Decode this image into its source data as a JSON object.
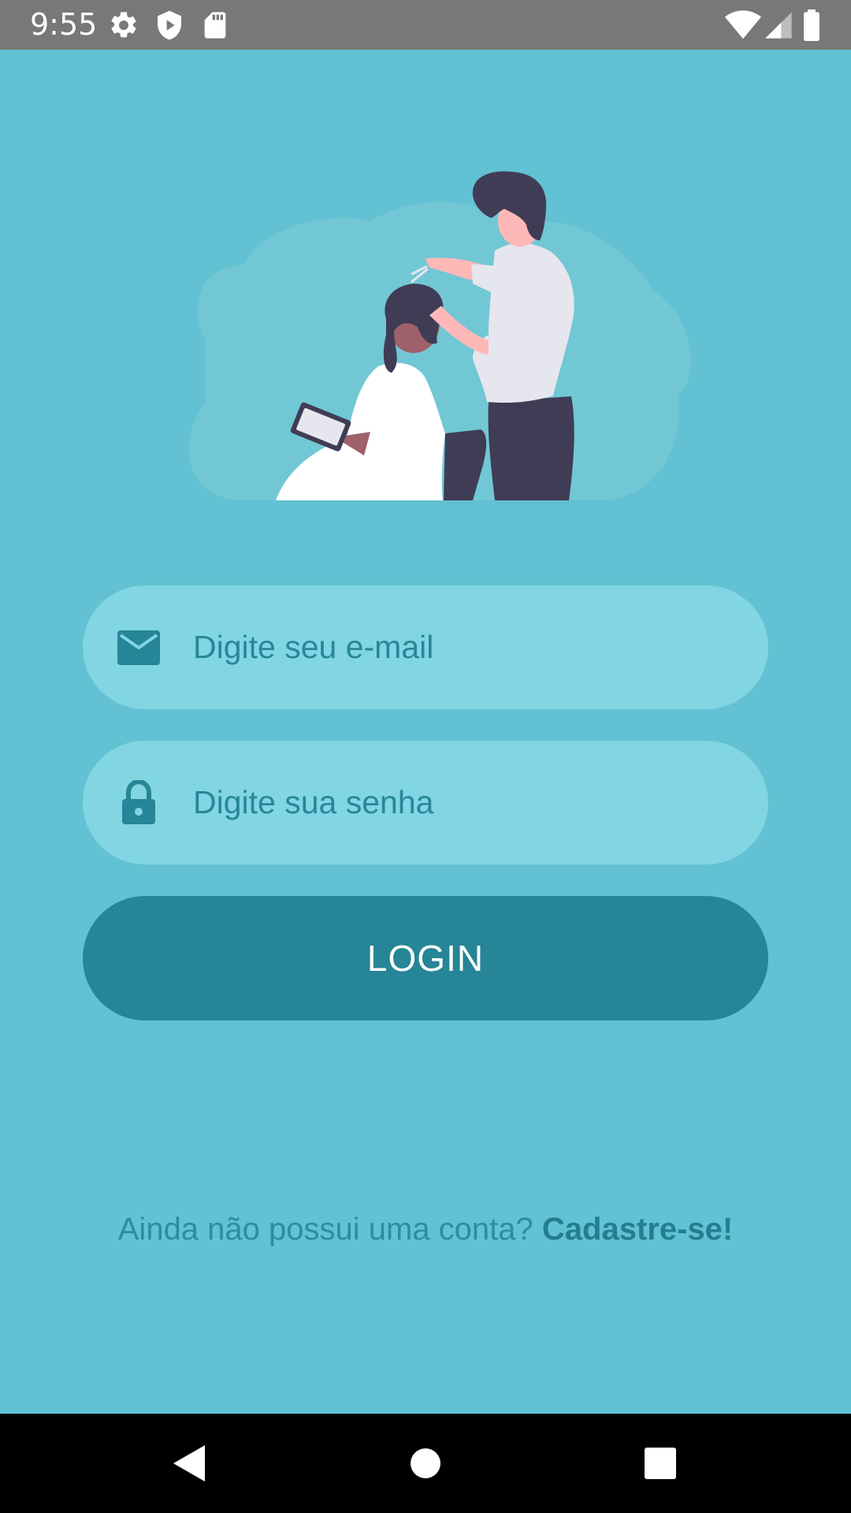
{
  "status_bar": {
    "time": "9:55",
    "left_icons": [
      "settings-icon",
      "shield-play-icon",
      "sd-card-icon"
    ],
    "right_icons": [
      "wifi-icon",
      "signal-icon",
      "battery-icon"
    ]
  },
  "illustration": {
    "name": "barber-cutting-hair-illustration"
  },
  "form": {
    "email": {
      "placeholder": "Digite seu e-mail",
      "value": "",
      "icon": "envelope-icon"
    },
    "password": {
      "placeholder": "Digite sua senha",
      "value": "",
      "icon": "lock-icon"
    },
    "login_label": "LOGIN"
  },
  "signup": {
    "prompt": "Ainda não possui uma conta?",
    "link_label": "Cadastre-se!"
  },
  "nav_bar": {
    "buttons": [
      "back-icon",
      "home-icon",
      "recents-icon"
    ]
  },
  "colors": {
    "background": "#62c1d2",
    "input_background": "#82d5e2",
    "accent": "#268596",
    "text_accent": "#2a8ea0",
    "status_bar": "#787878"
  }
}
